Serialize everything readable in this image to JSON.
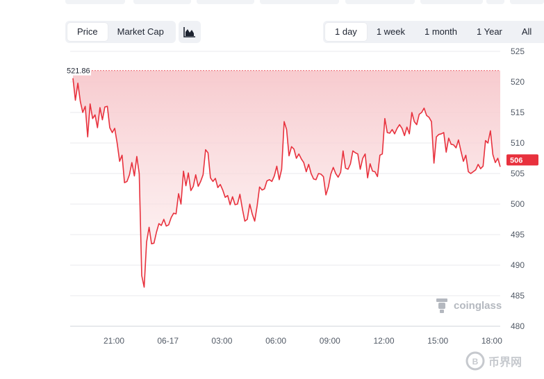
{
  "metric_toggle": {
    "options": [
      "Price",
      "Market Cap"
    ],
    "selected": "Price"
  },
  "range_toggle": {
    "options": [
      "1 day",
      "1 week",
      "1 month",
      "1 Year",
      "All"
    ],
    "selected": "1 day"
  },
  "chart_type_icon": "area-chart-icon",
  "watermark": "coinglass",
  "corner_logo_text": "币界网",
  "colors": {
    "line": "#e8313d",
    "fill_top": "#f7c8cc",
    "price_tag": "#e8313d"
  },
  "chart_data": {
    "type": "area",
    "xlabel": "",
    "ylabel": "",
    "x_ticks": [
      "21:00",
      "06-17",
      "03:00",
      "06:00",
      "09:00",
      "12:00",
      "15:00",
      "18:00"
    ],
    "y_ticks": [
      480,
      485,
      490,
      495,
      500,
      505,
      510,
      515,
      520,
      525
    ],
    "ylim": [
      480,
      525
    ],
    "grid": true,
    "max_marker": 521.86,
    "current_price_label": "506",
    "series": [
      {
        "values": [
          520.6,
          517.0,
          519.8,
          516.8,
          515.0,
          516.0,
          511.0,
          516.4,
          514.0,
          514.6,
          512.5,
          515.8,
          513.8,
          515.9,
          516.0,
          512.5,
          511.7,
          512.4,
          510.0,
          507.0,
          508.0,
          503.5,
          503.7,
          504.8,
          506.8,
          504.6,
          507.8,
          505.0,
          488.3,
          486.4,
          493.8,
          496.2,
          493.5,
          493.6,
          495.4,
          496.8,
          496.5,
          497.5,
          496.4,
          496.6,
          497.8,
          498.5,
          498.4,
          501.7,
          500.0,
          505.4,
          503.0,
          505.1,
          502.2,
          502.9,
          504.8,
          502.9,
          503.7,
          504.8,
          508.9,
          508.4,
          504.3,
          503.7,
          504.2,
          502.7,
          503.2,
          502.3,
          501.1,
          501.4,
          499.9,
          501.2,
          499.9,
          500.0,
          501.6,
          499.2,
          497.2,
          497.5,
          500.0,
          498.4,
          497.2,
          499.7,
          502.8,
          502.3,
          502.5,
          503.8,
          504.0,
          503.7,
          504.6,
          506.2,
          504.0,
          505.7,
          513.5,
          512.2,
          507.9,
          509.4,
          509.0,
          507.5,
          508.2,
          507.4,
          506.8,
          505.3,
          506.5,
          505.0,
          504.1,
          504.0,
          505.0,
          504.9,
          504.5,
          501.5,
          502.8,
          504.9,
          506.0,
          505.0,
          504.4,
          505.2,
          508.7,
          505.9,
          505.7,
          506.6,
          508.7,
          508.4,
          508.2,
          505.7,
          507.5,
          508.2,
          504.3,
          506.6,
          505.4,
          505.3,
          504.5,
          508.0,
          508.2,
          514.0,
          511.7,
          511.6,
          512.2,
          511.5,
          512.4,
          513.0,
          512.4,
          511.2,
          512.6,
          511.5,
          515.0,
          513.5,
          513.0,
          514.7,
          515.0,
          515.7,
          514.5,
          514.2,
          513.5,
          506.7,
          511.0,
          511.4,
          511.5,
          511.7,
          508.5,
          510.8,
          509.8,
          509.7,
          509.2,
          510.5,
          508.7,
          507.0,
          508.0,
          505.3,
          505.0,
          505.3,
          505.6,
          506.5,
          505.8,
          506.2,
          510.4,
          510.0,
          512.0,
          508.1,
          506.8,
          507.5,
          506.1
        ]
      }
    ]
  }
}
